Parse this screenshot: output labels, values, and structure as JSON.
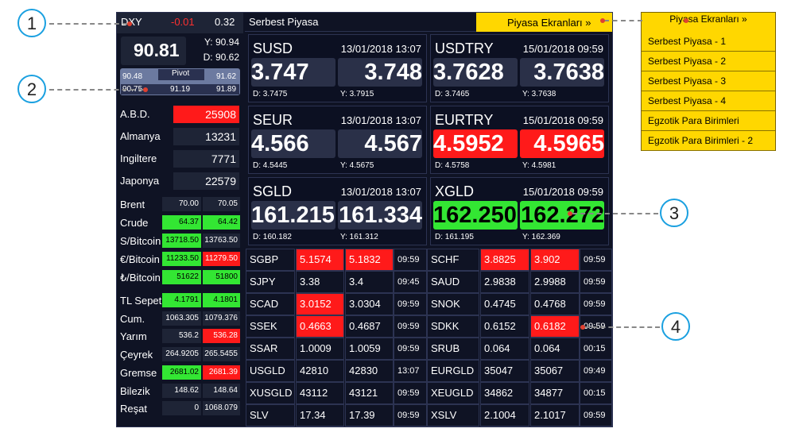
{
  "header": {
    "dxy_label": "DXY",
    "dxy_change": "-0.01",
    "dxy_change_pct": "0.32",
    "dxy_value": "90.81",
    "dxy_high": "Y: 90.94",
    "dxy_low": "D: 90.62",
    "pivot_label": "Pivot",
    "pivot_s1": "90.48",
    "pivot_r1": "91.62",
    "pivot_s2": "90.75",
    "pivot_p": "91.19",
    "pivot_r2": "91.89",
    "section_title": "Serbest Piyasa",
    "screens_button": "Piyasa Ekranları »"
  },
  "indices": [
    {
      "name": "A.B.D.",
      "value": "25908",
      "status": "red"
    },
    {
      "name": "Almanya",
      "value": "13231",
      "status": "neutral"
    },
    {
      "name": "Ingiltere",
      "value": "7771",
      "status": "neutral"
    },
    {
      "name": "Japonya",
      "value": "22579",
      "status": "neutral"
    }
  ],
  "commodities": [
    {
      "name": "Brent",
      "bid": "70.00",
      "ask": "70.05",
      "bid_status": "neutral",
      "ask_status": "neutral"
    },
    {
      "name": "Crude",
      "bid": "64.37",
      "ask": "64.42",
      "bid_status": "green",
      "ask_status": "green"
    },
    {
      "name": "S/Bitcoin",
      "bid": "13718.50",
      "ask": "13763.50",
      "bid_status": "green",
      "ask_status": "neutral"
    },
    {
      "name": "€/Bitcoin",
      "bid": "11233.50",
      "ask": "11279.50",
      "bid_status": "green",
      "ask_status": "red"
    },
    {
      "name": "₺/Bitcoin",
      "bid": "51622",
      "ask": "51800",
      "bid_status": "green",
      "ask_status": "green"
    }
  ],
  "gold": [
    {
      "name": "TL Sepeti",
      "bid": "4.1791",
      "ask": "4.1801",
      "bid_status": "green",
      "ask_status": "green"
    },
    {
      "name": "Cum.",
      "bid": "1063.305",
      "ask": "1079.376",
      "bid_status": "neutral",
      "ask_status": "neutral"
    },
    {
      "name": "Yarım",
      "bid": "536.2",
      "ask": "536.28",
      "bid_status": "neutral",
      "ask_status": "red"
    },
    {
      "name": "Çeyrek",
      "bid": "264.9205",
      "ask": "265.5455",
      "bid_status": "neutral",
      "ask_status": "neutral"
    },
    {
      "name": "Gremse",
      "bid": "2681.02",
      "ask": "2681.39",
      "bid_status": "green",
      "ask_status": "red"
    },
    {
      "name": "Bilezik",
      "bid": "148.62",
      "ask": "148.64",
      "bid_status": "neutral",
      "ask_status": "neutral"
    },
    {
      "name": "Reşat",
      "bid": "0",
      "ask": "1068.079",
      "bid_status": "neutral",
      "ask_status": "neutral"
    }
  ],
  "cards": [
    {
      "symbol": "SUSD",
      "date": "13/01/2018 13:07",
      "bid": "3.747",
      "ask": "3.748",
      "low": "D: 3.7475",
      "high": "Y: 3.7915",
      "bid_status": "neutral",
      "ask_status": "neutral"
    },
    {
      "symbol": "USDTRY",
      "date": "15/01/2018 09:59",
      "bid": "3.7628",
      "ask": "3.7638",
      "low": "D: 3.7465",
      "high": "Y: 3.7638",
      "bid_status": "neutral",
      "ask_status": "neutral"
    },
    {
      "symbol": "SEUR",
      "date": "13/01/2018 13:07",
      "bid": "4.566",
      "ask": "4.567",
      "low": "D: 4.5445",
      "high": "Y: 4.5675",
      "bid_status": "neutral",
      "ask_status": "neutral"
    },
    {
      "symbol": "EURTRY",
      "date": "15/01/2018 09:59",
      "bid": "4.5952",
      "ask": "4.5965",
      "low": "D: 4.5758",
      "high": "Y: 4.5981",
      "bid_status": "red",
      "ask_status": "red"
    },
    {
      "symbol": "SGLD",
      "date": "13/01/2018 13:07",
      "bid": "161.215",
      "ask": "161.334",
      "low": "D: 160.182",
      "high": "Y: 161.312",
      "bid_status": "neutral",
      "ask_status": "neutral"
    },
    {
      "symbol": "XGLD",
      "date": "15/01/2018 09:59",
      "bid": "162.250",
      "ask": "162.272",
      "low": "D: 161.195",
      "high": "Y: 162.369",
      "bid_status": "green",
      "ask_status": "green"
    }
  ],
  "grid": [
    {
      "l_sym": "SGBP",
      "l_bid": "5.1574",
      "l_ask": "5.1832",
      "l_time": "09:59",
      "l_bid_status": "red",
      "l_ask_status": "red",
      "r_sym": "SCHF",
      "r_bid": "3.8825",
      "r_ask": "3.902",
      "r_time": "09:59",
      "r_bid_status": "red",
      "r_ask_status": "red"
    },
    {
      "l_sym": "SJPY",
      "l_bid": "3.38",
      "l_ask": "3.4",
      "l_time": "09:45",
      "l_bid_status": "neutral",
      "l_ask_status": "neutral",
      "r_sym": "SAUD",
      "r_bid": "2.9838",
      "r_ask": "2.9988",
      "r_time": "09:59",
      "r_bid_status": "neutral",
      "r_ask_status": "neutral"
    },
    {
      "l_sym": "SCAD",
      "l_bid": "3.0152",
      "l_ask": "3.0304",
      "l_time": "09:59",
      "l_bid_status": "red",
      "l_ask_status": "neutral",
      "r_sym": "SNOK",
      "r_bid": "0.4745",
      "r_ask": "0.4768",
      "r_time": "09:59",
      "r_bid_status": "neutral",
      "r_ask_status": "neutral"
    },
    {
      "l_sym": "SSEK",
      "l_bid": "0.4663",
      "l_ask": "0.4687",
      "l_time": "09:59",
      "l_bid_status": "red",
      "l_ask_status": "neutral",
      "r_sym": "SDKK",
      "r_bid": "0.6152",
      "r_ask": "0.6182",
      "r_time": "09:59",
      "r_bid_status": "neutral",
      "r_ask_status": "red"
    },
    {
      "l_sym": "SSAR",
      "l_bid": "1.0009",
      "l_ask": "1.0059",
      "l_time": "09:59",
      "l_bid_status": "neutral",
      "l_ask_status": "neutral",
      "r_sym": "SRUB",
      "r_bid": "0.064",
      "r_ask": "0.064",
      "r_time": "00:15",
      "r_bid_status": "neutral",
      "r_ask_status": "neutral"
    },
    {
      "l_sym": "USGLD",
      "l_bid": "42810",
      "l_ask": "42830",
      "l_time": "13:07",
      "l_bid_status": "neutral",
      "l_ask_status": "neutral",
      "r_sym": "EURGLD",
      "r_bid": "35047",
      "r_ask": "35067",
      "r_time": "09:49",
      "r_bid_status": "neutral",
      "r_ask_status": "neutral"
    },
    {
      "l_sym": "XUSGLD",
      "l_bid": "43112",
      "l_ask": "43121",
      "l_time": "09:59",
      "l_bid_status": "neutral",
      "l_ask_status": "neutral",
      "r_sym": "XEUGLD",
      "r_bid": "34862",
      "r_ask": "34877",
      "r_time": "00:15",
      "r_bid_status": "neutral",
      "r_ask_status": "neutral"
    },
    {
      "l_sym": "SLV",
      "l_bid": "17.34",
      "l_ask": "17.39",
      "l_time": "09:59",
      "l_bid_status": "neutral",
      "l_ask_status": "neutral",
      "r_sym": "XSLV",
      "r_bid": "2.1004",
      "r_ask": "2.1017",
      "r_time": "09:59",
      "r_bid_status": "neutral",
      "r_ask_status": "neutral"
    }
  ],
  "dropdown": {
    "title": "Piyasa Ekranları »",
    "items": [
      "Serbest Piyasa - 1",
      "Serbest Piyasa - 2",
      "Serbest Piyasa - 3",
      "Serbest Piyasa - 4",
      "Egzotik Para Birimleri",
      "Egzotik Para Birimleri - 2"
    ]
  },
  "callouts": [
    "1",
    "2",
    "3",
    "4"
  ],
  "colors": {
    "green": "#33e633",
    "red": "#ff1a1a",
    "panel": "#0f1324",
    "accent": "#ffd700",
    "callout": "#1aa0e0"
  }
}
